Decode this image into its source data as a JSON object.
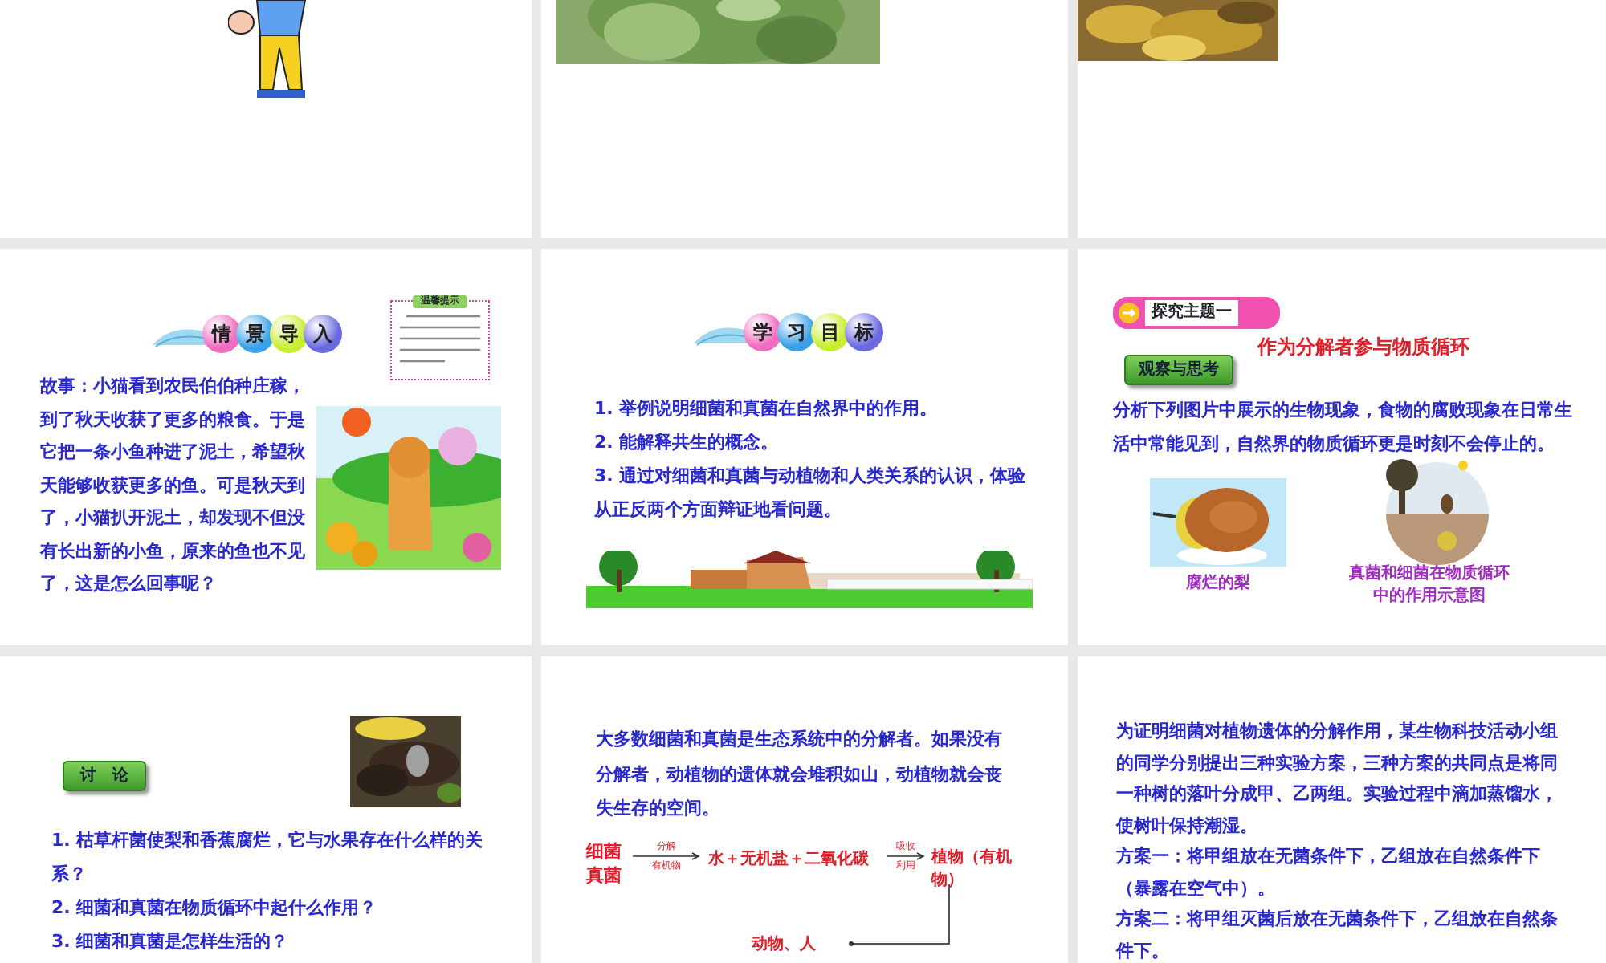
{
  "slides": [
    {
      "kind": "pictures"
    },
    {
      "kind": "pictures"
    },
    {
      "kind": "pictures"
    },
    {
      "kind": "story",
      "banner": [
        "情",
        "景",
        "导",
        "入"
      ],
      "note_title": "温馨提示",
      "text": "故事：小猫看到农民伯伯种庄稼，到了秋天收获了更多的粮食。于是它把一条小鱼种进了泥土，希望秋天能够收获更多的鱼。可是秋天到了，小猫扒开泥土，却发现不但没有长出新的小鱼，原来的鱼也不见了，这是怎么回事呢？"
    },
    {
      "kind": "goals",
      "banner": [
        "学",
        "习",
        "目",
        "标"
      ],
      "items": [
        "1. 举例说明细菌和真菌在自然界中的作用。",
        "2. 能解释共生的概念。",
        "3. 通过对细菌和真菌与动植物和人类关系的认识，体验从正反两个方面辩证地看问题。"
      ]
    },
    {
      "kind": "topic",
      "topic": "探究主题一",
      "title": "作为分解者参与物质循环",
      "tag": "观察与思考",
      "text": "分析下列图片中展示的生物现象，食物的腐败现象在日常生活中常能见到，自然界的物质循环更是时刻不会停止的。",
      "captions": [
        "腐烂的梨",
        "真菌和细菌在物质循环中的作用示意图"
      ]
    },
    {
      "kind": "discussion",
      "tag": "讨　论",
      "items": [
        "1. 枯草杆菌使梨和香蕉腐烂，它与水果存在什么样的关系？",
        "2. 细菌和真菌在物质循环中起什么作用？",
        "3. 细菌和真菌是怎样生活的？"
      ]
    },
    {
      "kind": "cycle",
      "text": "大多数细菌和真菌是生态系统中的分解者。如果没有分解者，动植物的遗体就会堆积如山，动植物就会丧失生存的空间。",
      "source": [
        "细菌",
        "真菌"
      ],
      "arrow1": [
        "分解",
        "有机物"
      ],
      "products": "水＋无机盐＋二氧化碳",
      "arrow2": [
        "吸收",
        "利用"
      ],
      "plant": "植物（有机物）",
      "consumers": "动物、人"
    },
    {
      "kind": "experiment",
      "paragraphs": [
        "为证明细菌对植物遗体的分解作用，某生物科技活动小组的同学分别提出三种实验方案，三种方案的共同点是将同一种树的落叶分成甲、乙两组。实验过程中滴加蒸馏水，使树叶保持潮湿。",
        "方案一：将甲组放在无菌条件下，乙组放在自然条件下（暴露在空气中）。",
        "方案二：将甲组灭菌后放在无菌条件下，乙组放在自然条件下。"
      ]
    }
  ]
}
